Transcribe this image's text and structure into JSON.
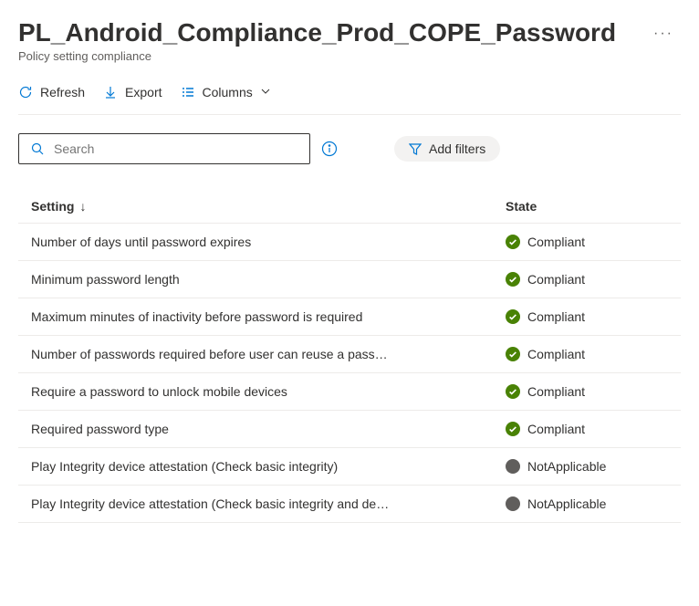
{
  "header": {
    "title": "PL_Android_Compliance_Prod_COPE_Password",
    "subtitle": "Policy setting compliance"
  },
  "toolbar": {
    "refresh": "Refresh",
    "export": "Export",
    "columns": "Columns"
  },
  "search": {
    "placeholder": "Search"
  },
  "filters": {
    "add": "Add filters"
  },
  "table": {
    "columns": {
      "setting": "Setting",
      "state": "State"
    },
    "rows": [
      {
        "setting": "Number of days until password expires",
        "state": "Compliant",
        "status": "compliant"
      },
      {
        "setting": "Minimum password length",
        "state": "Compliant",
        "status": "compliant"
      },
      {
        "setting": "Maximum minutes of inactivity before password is required",
        "state": "Compliant",
        "status": "compliant"
      },
      {
        "setting": "Number of passwords required before user can reuse a pass…",
        "state": "Compliant",
        "status": "compliant"
      },
      {
        "setting": "Require a password to unlock mobile devices",
        "state": "Compliant",
        "status": "compliant"
      },
      {
        "setting": "Required password type",
        "state": "Compliant",
        "status": "compliant"
      },
      {
        "setting": "Play Integrity device attestation (Check basic integrity)",
        "state": "NotApplicable",
        "status": "notapplicable"
      },
      {
        "setting": "Play Integrity device attestation (Check basic integrity and de…",
        "state": "NotApplicable",
        "status": "notapplicable"
      }
    ]
  }
}
